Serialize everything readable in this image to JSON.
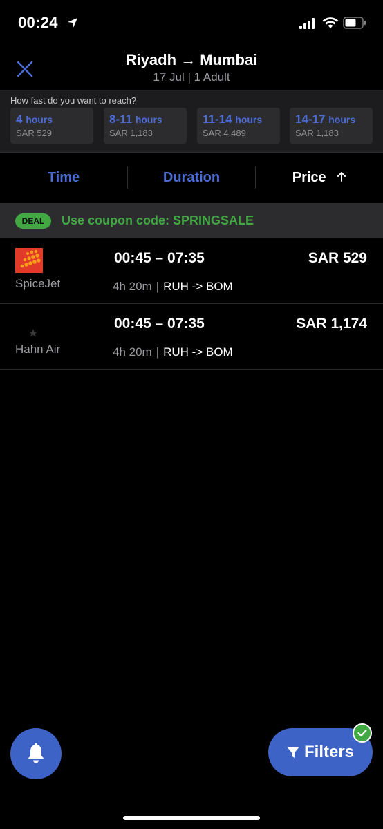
{
  "status_bar": {
    "time": "00:24"
  },
  "header": {
    "title": "Riyadh → Mumbai",
    "subtitle": "17 Jul | 1 Adult"
  },
  "duration_filter": {
    "question": "How fast do you want to reach?",
    "options": [
      {
        "value": "4",
        "unit": "hours",
        "price": "SAR 529"
      },
      {
        "value": "8-11",
        "unit": "hours",
        "price": "SAR 1,183"
      },
      {
        "value": "11-14",
        "unit": "hours",
        "price": "SAR 4,489"
      },
      {
        "value": "14-17",
        "unit": "hours",
        "price": "SAR 1,183"
      }
    ]
  },
  "sort": {
    "time": "Time",
    "duration": "Duration",
    "price": "Price",
    "active": "price",
    "direction": "ascending",
    "active_color": "#ffffff",
    "inactive_color": "#4a6cd4"
  },
  "deal": {
    "badge": "DEAL",
    "text": "Use coupon code: SPRINGSALE"
  },
  "flights": [
    {
      "airline": "SpiceJet",
      "times": "00:45 – 07:35",
      "duration": "4h 20m",
      "route": "RUH -> BOM",
      "price": "SAR 529",
      "logo": "spicejet-logo"
    },
    {
      "airline": "Hahn Air",
      "times": "00:45 – 07:35",
      "duration": "4h 20m",
      "route": "RUH -> BOM",
      "price": "SAR 1,174",
      "logo": "hahn-air-logo"
    }
  ],
  "actions": {
    "filters_label": "Filters",
    "filters_applied": true
  },
  "colors": {
    "accent": "#3d63c6",
    "link": "#4a6cd4",
    "deal_green": "#41a844",
    "spicejet_red": "#e23a28"
  }
}
